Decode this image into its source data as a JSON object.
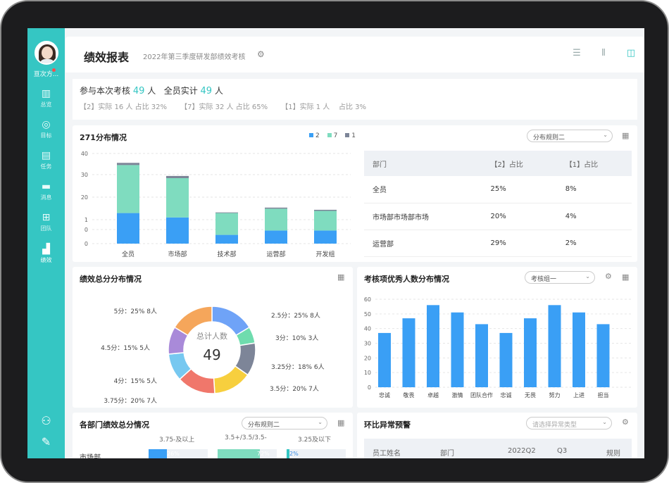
{
  "sidebar": {
    "user_name": "亘次方...",
    "items": [
      {
        "label": "总览",
        "icon": "chart-icon"
      },
      {
        "label": "目标",
        "icon": "target-icon"
      },
      {
        "label": "任务",
        "icon": "task-icon"
      },
      {
        "label": "消息",
        "icon": "message-icon"
      },
      {
        "label": "团队",
        "icon": "team-icon"
      },
      {
        "label": "绩效",
        "icon": "performance-icon"
      }
    ]
  },
  "header": {
    "title": "绩效报表",
    "subtitle": "2022年第三季度研发部绩效考核"
  },
  "summary": {
    "p1": "参与本次考核",
    "n1": "49",
    "u1": "人",
    "p2": "全员实计",
    "n2": "49",
    "u2": "人",
    "breakdown": "【2】实际 16 人 占比 32%      【7】实际 32 人 占比 65%      【1】实际 1 人    占比 3%"
  },
  "dist": {
    "title": "271分布情况",
    "select": "分布规则二",
    "legend": [
      "2",
      "7",
      "1"
    ],
    "table_headers": [
      "部门",
      "【2】占比",
      "【1】占比"
    ],
    "rows": [
      {
        "dept": "全员",
        "a": "25%",
        "b": "8%"
      },
      {
        "dept": "市场部市场部市场",
        "a": "20%",
        "b": "4%"
      },
      {
        "dept": "运营部",
        "a": "29%",
        "b": "2%"
      }
    ]
  },
  "donut": {
    "title": "绩效总分分布情况",
    "center_label": "总计人数",
    "center_value": "49",
    "labels": [
      "2.5分：25% 8人",
      "3分：10% 3人",
      "3.25分：18% 6人",
      "3.5分：20% 7人",
      "3.75分：20% 7人",
      "4分：15% 5人",
      "4.5分：15% 5人",
      "5分：25% 8人"
    ]
  },
  "excellent": {
    "title": "考核项优秀人数分布情况",
    "select": "考核组一"
  },
  "dept_score": {
    "title": "各部门绩效总分情况",
    "select": "分布规则二",
    "cols": [
      "3.75-及以上",
      "3.5+/3.5/3.5-",
      "3.25及以下"
    ],
    "row": "市场部",
    "vals": [
      "26%",
      "72%",
      "2%"
    ]
  },
  "anomaly": {
    "title": "环比异常预警",
    "placeholder": "请选择异常类型",
    "headers": [
      "员工姓名",
      "部门",
      "2022Q2",
      "Q3",
      "规则"
    ]
  },
  "chart_data": [
    {
      "type": "bar",
      "title": "271分布情况",
      "categories": [
        "全员",
        "市场部",
        "技术部",
        "运营部",
        "开发组"
      ],
      "series": [
        {
          "name": "2",
          "values": [
            14,
            12,
            4,
            6,
            6
          ],
          "color": "#3a9ff5"
        },
        {
          "name": "7",
          "values": [
            22,
            18,
            10,
            10,
            9
          ],
          "color": "#7fdcbf"
        },
        {
          "name": "1",
          "values": [
            1,
            1,
            0.3,
            0.5,
            0.5
          ],
          "color": "#7d8598"
        }
      ],
      "yticks": [
        "40",
        "30",
        "20",
        "1",
        "0",
        "0"
      ]
    },
    {
      "type": "pie",
      "title": "绩效总分分布情况",
      "values": [
        8,
        3,
        6,
        7,
        7,
        5,
        5,
        8
      ],
      "colors": [
        "#6fa3f7",
        "#6fdcae",
        "#7d8598",
        "#f7cf3e",
        "#f0776b",
        "#77c8f0",
        "#a98ad9",
        "#f5a65b"
      ]
    },
    {
      "type": "bar",
      "title": "考核项优秀人数分布情况",
      "categories": [
        "忠诚",
        "敬畏",
        "卓越",
        "激情",
        "团队合作",
        "忠诚",
        "无畏",
        "努力",
        "上进",
        "担当"
      ],
      "values": [
        37,
        47,
        56,
        51,
        43,
        37,
        47,
        56,
        51,
        43
      ],
      "ylim": [
        0,
        60
      ],
      "yticks": [
        "0",
        "10",
        "20",
        "30",
        "40",
        "50",
        "60"
      ],
      "color": "#3a9ff5"
    }
  ]
}
